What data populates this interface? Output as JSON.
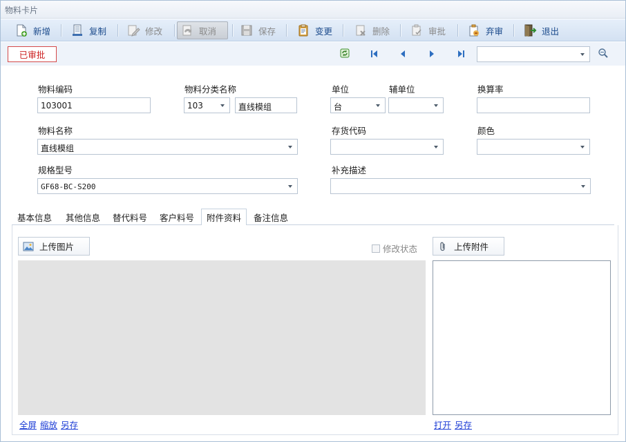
{
  "window": {
    "title": "物料卡片"
  },
  "toolbar": {
    "buttons": [
      {
        "label": "新增",
        "icon": "new-doc-icon",
        "state": "enabled"
      },
      {
        "label": "复制",
        "icon": "copy-icon",
        "state": "enabled"
      },
      {
        "label": "修改",
        "icon": "edit-icon",
        "state": "disabled"
      },
      {
        "label": "取消",
        "icon": "cancel-icon",
        "state": "pressed"
      },
      {
        "label": "保存",
        "icon": "save-icon",
        "state": "disabled"
      },
      {
        "label": "变更",
        "icon": "change-icon",
        "state": "enabled"
      },
      {
        "label": "删除",
        "icon": "delete-icon",
        "state": "disabled"
      },
      {
        "label": "审批",
        "icon": "approve-icon",
        "state": "disabled"
      },
      {
        "label": "弃审",
        "icon": "unapprove-icon",
        "state": "enabled"
      },
      {
        "label": "退出",
        "icon": "exit-icon",
        "state": "enabled"
      }
    ]
  },
  "status": {
    "badge": "已审批"
  },
  "nav": {
    "search_value": ""
  },
  "form": {
    "code": {
      "label": "物料编码",
      "value": "103001"
    },
    "category": {
      "label": "物料分类名称",
      "code": "103",
      "name": "直线模组"
    },
    "unit": {
      "label": "单位",
      "value": "台"
    },
    "aux_unit": {
      "label": "辅单位",
      "value": ""
    },
    "conversion": {
      "label": "换算率",
      "value": ""
    },
    "name": {
      "label": "物料名称",
      "value": "直线模组"
    },
    "inventory_code": {
      "label": "存货代码",
      "value": ""
    },
    "color": {
      "label": "颜色",
      "value": ""
    },
    "spec": {
      "label": "规格型号",
      "value": "GF68-BC-S200"
    },
    "supplement": {
      "label": "补充描述",
      "value": ""
    }
  },
  "tabs": [
    {
      "label": "基本信息",
      "active": false
    },
    {
      "label": "其他信息",
      "active": false
    },
    {
      "label": "替代料号",
      "active": false
    },
    {
      "label": "客户料号",
      "active": false
    },
    {
      "label": "附件资料",
      "active": true
    },
    {
      "label": "备注信息",
      "active": false
    }
  ],
  "attachments": {
    "upload_image_label": "上传图片",
    "modify_status_label": "修改状态",
    "modify_status_checked": false,
    "upload_attachment_label": "上传附件",
    "image_links": [
      "全屏",
      "缩放",
      "另存"
    ],
    "attachment_links": [
      "打开",
      "另存"
    ]
  },
  "colors": {
    "accent": "#1c4b8c",
    "badge_red": "#cc2222",
    "link_blue": "#1f3fd6"
  }
}
